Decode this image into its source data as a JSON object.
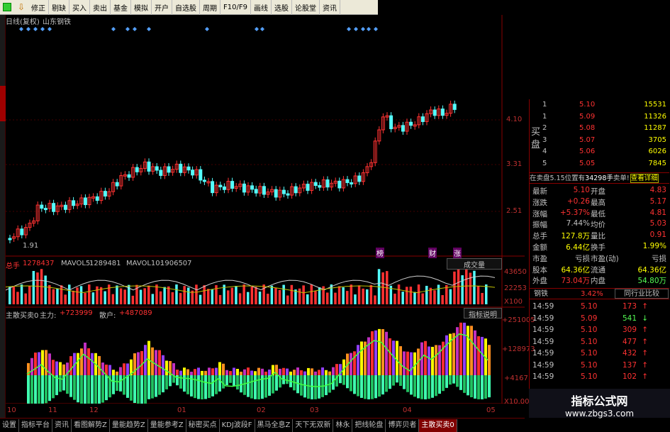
{
  "toolbar": {
    "items": [
      "修正",
      "剔缺",
      "买入",
      "卖出",
      "基金",
      "模拟",
      "开户",
      "自选股",
      "周期",
      "F10/F9",
      "画线",
      "选股",
      "论股堂",
      "资讯"
    ],
    "icons": [
      "green-square-icon",
      "arrow-down-icon"
    ]
  },
  "chart": {
    "title": "日线(复权)",
    "stock": "山东钢铁",
    "price_ticks": [
      "4.10",
      "3.31",
      "2.51"
    ],
    "low_label": "1.91",
    "markers": [
      "榜",
      "财",
      "涨"
    ]
  },
  "volume": {
    "total_label": "总手",
    "total_value": "1278437",
    "mavol5_label": "MAVOL5:",
    "mavol5_value": "1289481",
    "mavol10_label": "MAVOL10:",
    "mavol10_value": "1906507",
    "selector": "成交量",
    "ticks": [
      "43650",
      "22253",
      "X100"
    ]
  },
  "indicator": {
    "name": "主散买卖0",
    "main_label": "主力:",
    "main_value": "+723999",
    "retail_label": "散户:",
    "retail_value": "+487089",
    "help_button": "指标说明",
    "ticks": [
      "+251005",
      "+128973",
      "+4167",
      "X10.00"
    ]
  },
  "date_axis": [
    "10",
    "11",
    "12",
    "01",
    "02",
    "03",
    "04",
    "05"
  ],
  "orderbook": {
    "buy_label": "买盘",
    "rows": [
      {
        "n": "1",
        "price": "5.10",
        "vol": "15531"
      },
      {
        "n": "1",
        "price": "5.09",
        "vol": "11326"
      },
      {
        "n": "2",
        "price": "5.08",
        "vol": "11287"
      },
      {
        "n": "3",
        "price": "5.07",
        "vol": "3705"
      },
      {
        "n": "4",
        "price": "5.06",
        "vol": "6026"
      },
      {
        "n": "5",
        "price": "5.05",
        "vol": "7845"
      }
    ]
  },
  "sell_info": {
    "text1": "在卖盘5.15位置有",
    "vol": "34298手",
    "text2": "卖单!",
    "link": "查看详细"
  },
  "quote": [
    {
      "l1": "最新",
      "v1": "5.10",
      "l2": "开盘",
      "v2": "4.83"
    },
    {
      "l1": "涨跌",
      "v1": "+0.26",
      "l2": "最高",
      "v2": "5.17"
    },
    {
      "l1": "涨幅",
      "v1": "+5.37%",
      "l2": "最低",
      "v2": "4.81"
    },
    {
      "l1": "振幅",
      "v1": "7.44%",
      "l2": "均价",
      "v2": "5.03"
    },
    {
      "l1": "总手",
      "v1": "127.8万",
      "l2": "量比",
      "v2": "0.91"
    },
    {
      "l1": "金额",
      "v1": "6.44亿",
      "l2": "换手",
      "v2": "1.99%"
    },
    {
      "l1": "市盈",
      "v1": "亏损",
      "l2": "市盈(动)",
      "v2": "亏损"
    },
    {
      "l1": "股本",
      "v1": "64.36亿",
      "l2": "流通",
      "v2": "64.36亿"
    },
    {
      "l1": "外盘",
      "v1": "73.04万",
      "l2": "内盘",
      "v2": "54.80万"
    }
  ],
  "industry": {
    "name": "钢铁",
    "change": "3.42%",
    "button": "同行业比较"
  },
  "ticks_list": [
    {
      "t": "14:59",
      "p": "5.10",
      "v": "173",
      "d": "up"
    },
    {
      "t": "14:59",
      "p": "5.09",
      "v": "541",
      "d": "down"
    },
    {
      "t": "14:59",
      "p": "5.10",
      "v": "309",
      "d": "up"
    },
    {
      "t": "14:59",
      "p": "5.10",
      "v": "477",
      "d": "up"
    },
    {
      "t": "14:59",
      "p": "5.10",
      "v": "432",
      "d": "up"
    },
    {
      "t": "14:59",
      "p": "5.10",
      "v": "137",
      "d": "up"
    },
    {
      "t": "14:59",
      "p": "5.10",
      "v": "102",
      "d": "up"
    }
  ],
  "bottom_tabs": [
    "设置",
    "指标平台",
    "资讯",
    "看图解势Z",
    "量能趋势Z",
    "量能参考Z",
    "秘密买点",
    "KDJ波段F",
    "黑马全息Z",
    "天下无双新",
    "林永",
    "把线轮盘",
    "博弈贝者",
    "主散买卖0"
  ],
  "watermark": {
    "title": "指标公式网",
    "url": "www.zbgs3.com"
  },
  "colors": {
    "up": "#ff3232",
    "down": "#54fcfc",
    "yellow": "#ffff00",
    "bg": "#000000"
  }
}
